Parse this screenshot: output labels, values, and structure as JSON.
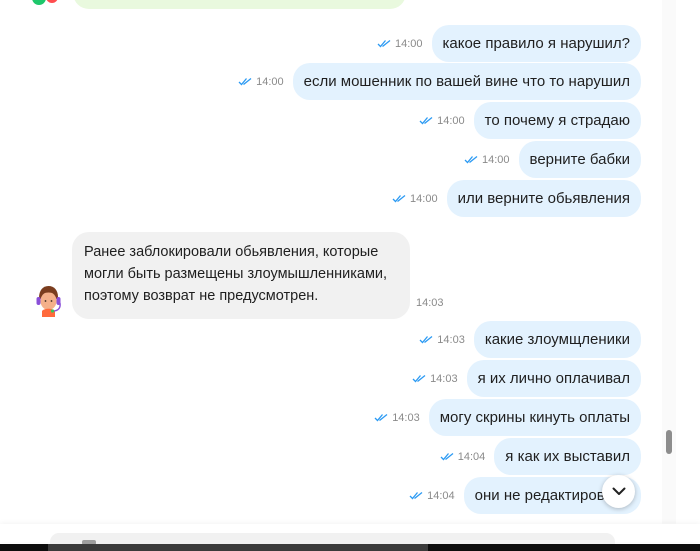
{
  "messages_out_top": [
    {
      "time": "14:00",
      "text": "какое правило я нарушил?"
    },
    {
      "time": "14:00",
      "text": "если мошенник по вашей вине что то нарушил"
    },
    {
      "time": "14:00",
      "text": "то почему я страдаю"
    },
    {
      "time": "14:00",
      "text": "верните бабки"
    },
    {
      "time": "14:00",
      "text": "или верните обьявления"
    }
  ],
  "incoming": {
    "avatar": "support-agent-headset-icon",
    "text": "Ранее заблокировали обьявления, которые могли быть размещены злоумышленниками, поэтому возврат не предусмотрен.",
    "time": "14:03"
  },
  "messages_out_bottom": [
    {
      "time": "14:03",
      "text": "какие злоумщленики"
    },
    {
      "time": "14:03",
      "text": "я их лично оплачивал"
    },
    {
      "time": "14:03",
      "text": "могу скрины кинуть оплаты"
    },
    {
      "time": "14:04",
      "text": "я как их выставил"
    },
    {
      "time": "14:04",
      "text": "они не редактировали"
    }
  ],
  "colors": {
    "outgoing_bubble": "#e3f2fe",
    "incoming_bubble": "#f1f1f1",
    "read_ticks": "#2b9af3"
  },
  "icons": {
    "read_status": "double-check-icon",
    "scroll_down": "chevron-down-icon"
  }
}
